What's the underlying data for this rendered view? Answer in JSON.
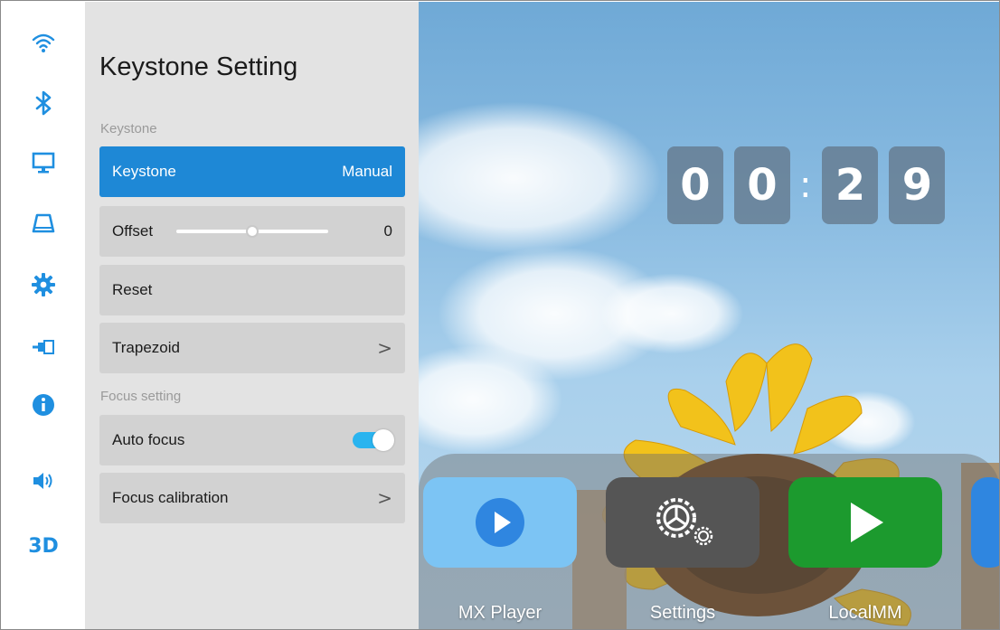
{
  "rail": {
    "icons": [
      "wifi-icon",
      "bluetooth-icon",
      "display-icon",
      "keystone-icon",
      "gear-icon",
      "input-source-icon",
      "info-icon",
      "volume-icon"
    ],
    "three_d_label": "3D",
    "accent": "#1f8fe0"
  },
  "panel": {
    "title": "Keystone Setting",
    "keystone_section": "Keystone",
    "keystone_row": {
      "label": "Keystone",
      "value": "Manual"
    },
    "offset_row": {
      "label": "Offset",
      "value": "0",
      "slider_level": 0.5
    },
    "reset_row": {
      "label": "Reset"
    },
    "trapezoid_row": {
      "label": "Trapezoid",
      "chevron": ">"
    },
    "focus_section": "Focus setting",
    "auto_focus_row": {
      "label": "Auto focus",
      "toggle_on": true
    },
    "focus_calibration_row": {
      "label": "Focus calibration",
      "chevron": ">"
    }
  },
  "clock": {
    "d1": "0",
    "d2": "0",
    "separator": ":",
    "d3": "2",
    "d4": "9"
  },
  "dock": {
    "apps": [
      {
        "label": "MX Player",
        "icon": "play-circle-icon",
        "color": "#7cc4f4"
      },
      {
        "label": "Settings",
        "icon": "gear-icon",
        "color": "#555555"
      },
      {
        "label": "LocalMM",
        "icon": "play-triangle-icon",
        "color": "#1c9a2e"
      }
    ]
  },
  "colors": {
    "active_row": "#1e88d6",
    "toggle": "#2ab4ef",
    "panel_bg": "#e3e3e3"
  }
}
